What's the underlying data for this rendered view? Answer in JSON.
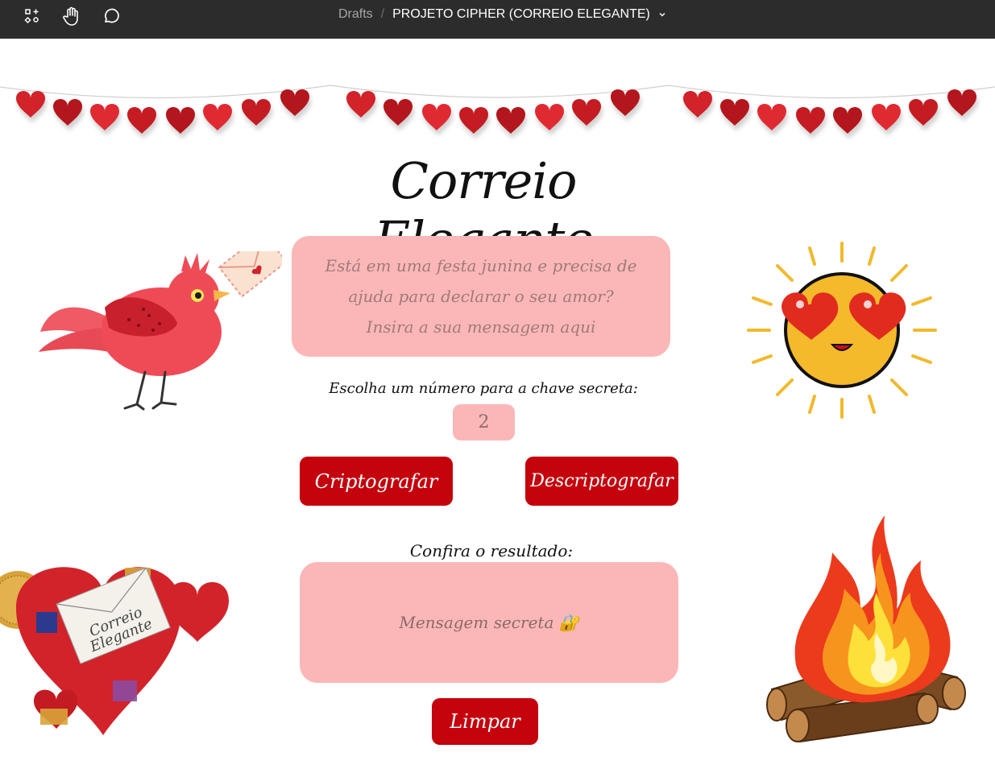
{
  "toolbar": {
    "breadcrumb_parent": "Drafts",
    "breadcrumb_separator": "/",
    "project_title": "PROJETO CIPHER (CORREIO ELEGANTE)",
    "icons": [
      "frame-tool-icon",
      "hand-tool-icon",
      "comment-icon",
      "chevron-down-icon"
    ]
  },
  "page": {
    "title": "Correio Elegante",
    "message_placeholder": "Está em uma festa junina e precisa de ajuda para declarar o seu amor?\nInsira a sua mensagem aqui",
    "key_label": "Escolha um número para a chave secreta:",
    "key_value": "2",
    "encrypt_label": "Criptografar",
    "decrypt_label": "Descriptografar",
    "result_label": "Confira o resultado:",
    "result_placeholder": "Mensagem secreta 🔐",
    "clear_label": "Limpar"
  },
  "colors": {
    "toolbar_bg": "#2c2c2c",
    "accent_red": "#c4030d",
    "pink_box": "#fbb7b7",
    "heart_red": "#d2232a"
  },
  "decorations": [
    "heart-garland",
    "bird-with-letter-illustration",
    "heart-eyes-sun-illustration",
    "correio-elegante-heart-illustration",
    "bonfire-illustration"
  ]
}
